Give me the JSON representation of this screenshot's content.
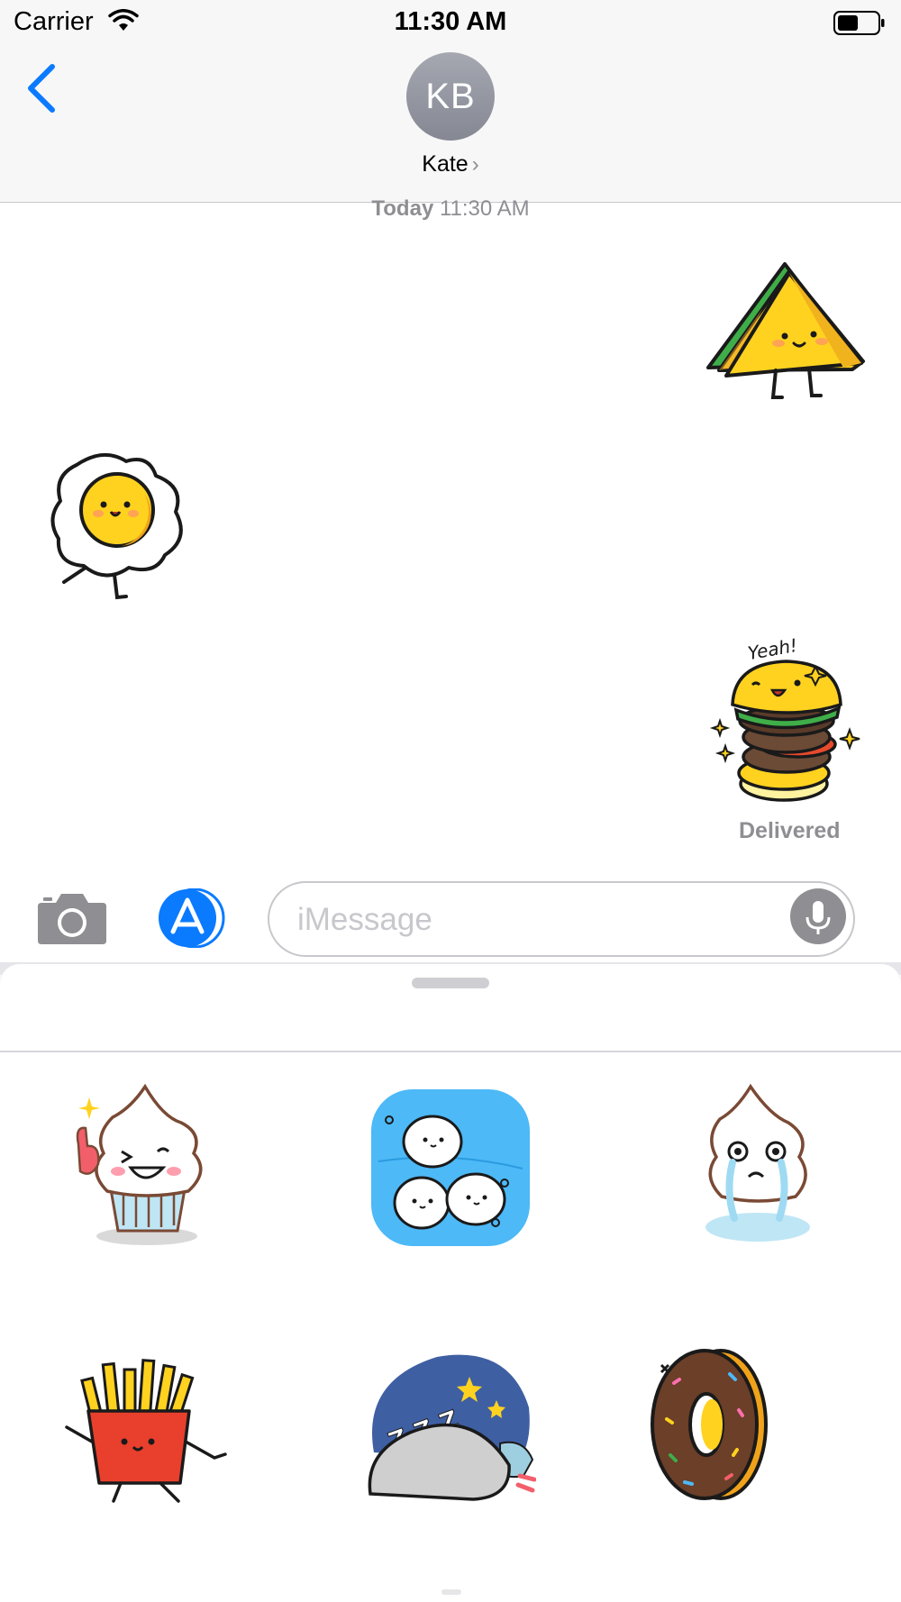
{
  "status_bar": {
    "carrier": "Carrier",
    "time": "11:30 AM",
    "icons": [
      "wifi-icon",
      "battery-icon"
    ]
  },
  "header": {
    "back_icon": "chevron-left-icon",
    "avatar_initials": "KB",
    "contact_name": "Kate",
    "contact_chevron": "›"
  },
  "conversation": {
    "timestamp_day": "Today",
    "timestamp_time": "11:30 AM",
    "messages": [
      {
        "side": "right",
        "sticker": "sandwich-sticker"
      },
      {
        "side": "left",
        "sticker": "fried-egg-sticker"
      },
      {
        "side": "right",
        "sticker": "burger-stack-sticker",
        "sticker_text": "Yeah!"
      }
    ],
    "delivered_label": "Delivered"
  },
  "input_bar": {
    "camera_icon": "camera-icon",
    "appstore_icon": "app-store-icon",
    "placeholder": "iMessage",
    "mic_icon": "microphone-icon"
  },
  "sticker_drawer": {
    "items": [
      {
        "name": "ice-cream-wink-sticker"
      },
      {
        "name": "snowballs-sticker"
      },
      {
        "name": "ice-cream-crying-sticker"
      },
      {
        "name": "fries-sticker"
      },
      {
        "name": "sleeping-rice-sticker",
        "sticker_text": "Z Z Z"
      },
      {
        "name": "donut-sticker"
      }
    ]
  },
  "colors": {
    "accent_blue": "#0a7aff",
    "gray_label": "#8e8e93",
    "sticker_yellow": "#ffd21f",
    "sticker_outline": "#1a1a1a"
  }
}
